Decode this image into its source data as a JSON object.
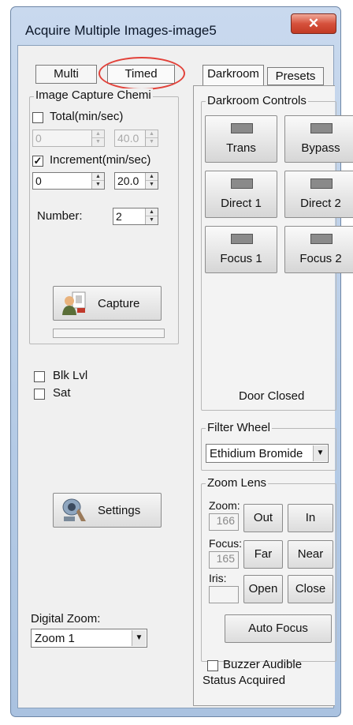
{
  "window": {
    "title": "Acquire Multiple Images-image5",
    "close_icon": "close-icon"
  },
  "mode_tabs": {
    "multi": "Multi",
    "timed": "Timed"
  },
  "capture_group": {
    "legend": "Image Capture Chemi",
    "total": {
      "label": "Total(min/sec)",
      "checked": false,
      "min": "0",
      "sec": "40.0"
    },
    "increment": {
      "label": "Increment(min/sec)",
      "checked": true,
      "min": "0",
      "sec": "20.0"
    },
    "number_label": "Number:",
    "number_value": "2",
    "capture_label": "Capture"
  },
  "blk_lvl": {
    "label": "Blk Lvl",
    "checked": false
  },
  "sat": {
    "label": "Sat",
    "checked": false
  },
  "settings_label": "Settings",
  "digital_zoom": {
    "label": "Digital Zoom:",
    "value": "Zoom 1"
  },
  "right_tabs": {
    "darkroom": "Darkroom",
    "presets": "Presets"
  },
  "darkroom_controls": {
    "legend": "Darkroom Controls",
    "buttons": [
      "Trans",
      "Bypass",
      "Direct 1",
      "Direct 2",
      "Focus 1",
      "Focus 2"
    ],
    "door_status": "Door Closed"
  },
  "filter_wheel": {
    "legend": "Filter Wheel",
    "value": "Ethidium Bromide"
  },
  "zoom_lens": {
    "legend": "Zoom Lens",
    "zoom_label": "Zoom:",
    "zoom_value": "166",
    "focus_label": "Focus:",
    "focus_value": "165",
    "iris_label": "Iris:",
    "iris_value": "",
    "out": "Out",
    "in": "In",
    "far": "Far",
    "near": "Near",
    "open": "Open",
    "close": "Close",
    "auto_focus": "Auto Focus"
  },
  "buzzer": {
    "label": "Buzzer Audible",
    "checked": false
  },
  "status": "Status Acquired",
  "colors": {
    "highlight": "#e2423a",
    "close_button": "#d6513c"
  }
}
